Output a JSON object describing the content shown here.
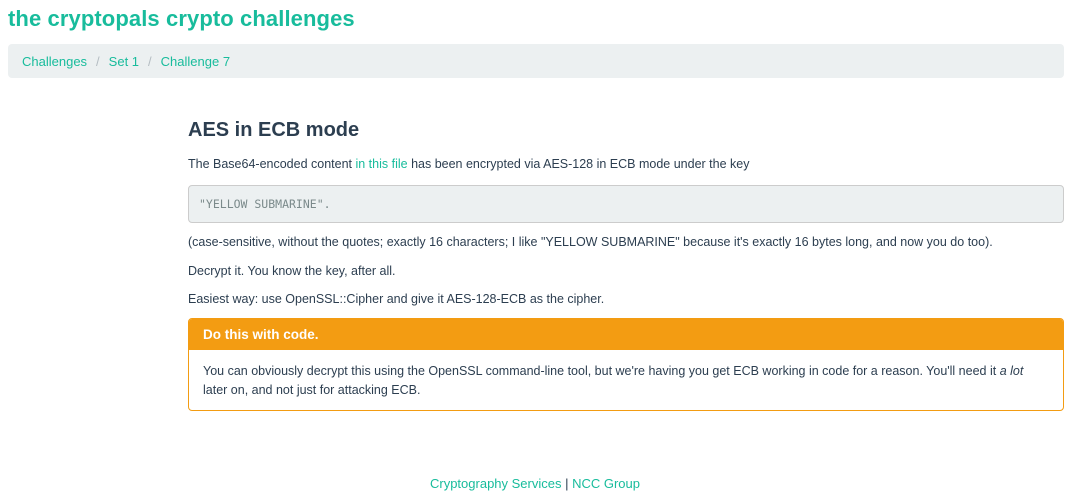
{
  "header": {
    "title": "the cryptopals crypto challenges"
  },
  "breadcrumb": {
    "items": [
      "Challenges",
      "Set 1",
      "Challenge 7"
    ],
    "separator": "/"
  },
  "challenge": {
    "title": "AES in ECB mode",
    "intro_before": "The Base64-encoded content ",
    "intro_link": "in this file",
    "intro_after": " has been encrypted via AES-128 in ECB mode under the key",
    "key": "\"YELLOW SUBMARINE\".",
    "note": "(case-sensitive, without the quotes; exactly 16 characters; I like \"YELLOW SUBMARINE\" because it's exactly 16 bytes long, and now you do too).",
    "decrypt": "Decrypt it. You know the key, after all.",
    "easiest": "Easiest way: use OpenSSL::Cipher and give it AES-128-ECB as the cipher."
  },
  "panel": {
    "heading": "Do this with code.",
    "body_before": "You can obviously decrypt this using the OpenSSL command-line tool, but we're having you get ECB working in code for a reason. You'll need it ",
    "body_em": "a lot",
    "body_after": " later on, and not just for attacking ECB."
  },
  "footer": {
    "link1": "Cryptography Services",
    "separator": " | ",
    "link2": "NCC Group"
  },
  "colors": {
    "brand": "#18bc9c",
    "text": "#2c3e50",
    "warning": "#f39c12",
    "well": "#ecf0f1"
  }
}
